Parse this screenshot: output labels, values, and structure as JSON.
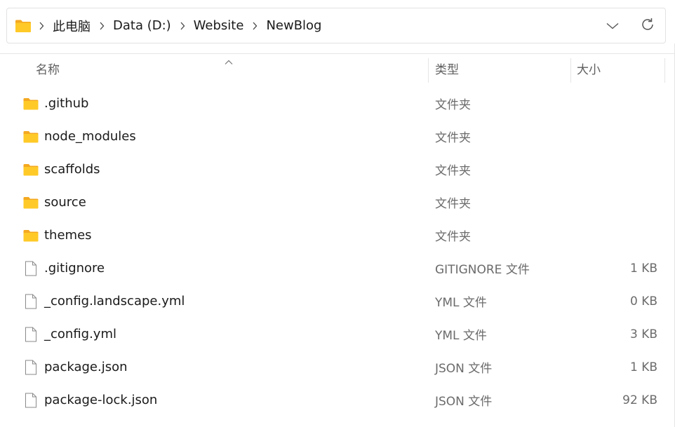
{
  "address_bar": {
    "icon": "folder-icon",
    "crumbs": [
      "此电脑",
      "Data (D:)",
      "Website",
      "NewBlog"
    ],
    "dropdown_icon": "chevron-down-icon",
    "refresh_icon": "refresh-icon"
  },
  "columns": {
    "name": "名称",
    "type": "类型",
    "size": "大小",
    "sort_indicator": "sort-ascending-caret"
  },
  "files": [
    {
      "icon": "folder-icon",
      "name": ".github",
      "type": "文件夹",
      "size": ""
    },
    {
      "icon": "folder-icon",
      "name": "node_modules",
      "type": "文件夹",
      "size": ""
    },
    {
      "icon": "folder-icon",
      "name": "scaffolds",
      "type": "文件夹",
      "size": ""
    },
    {
      "icon": "folder-icon",
      "name": "source",
      "type": "文件夹",
      "size": ""
    },
    {
      "icon": "folder-icon",
      "name": "themes",
      "type": "文件夹",
      "size": ""
    },
    {
      "icon": "file-icon",
      "name": ".gitignore",
      "type": "GITIGNORE 文件",
      "size": "1 KB"
    },
    {
      "icon": "file-icon",
      "name": "_config.landscape.yml",
      "type": "YML 文件",
      "size": "0 KB"
    },
    {
      "icon": "file-icon",
      "name": "_config.yml",
      "type": "YML 文件",
      "size": "3 KB"
    },
    {
      "icon": "file-icon",
      "name": "package.json",
      "type": "JSON 文件",
      "size": "1 KB"
    },
    {
      "icon": "file-icon",
      "name": "package-lock.json",
      "type": "JSON 文件",
      "size": "92 KB"
    }
  ],
  "colors": {
    "folder_front": "#FFCA28",
    "folder_back": "#F4A820",
    "divider": "#e5e5e5",
    "header_text": "#5f5f5f",
    "secondary_text": "#6b6b6b"
  }
}
